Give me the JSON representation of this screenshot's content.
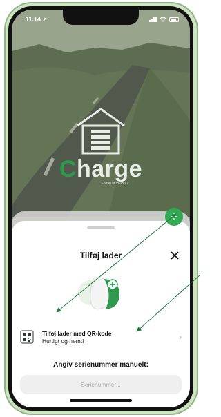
{
  "status_bar": {
    "time": "11.14",
    "location_arrow": "location-arrow-icon"
  },
  "brand": {
    "first_letter": "C",
    "rest": "harge",
    "tagline": "En del af VERDO"
  },
  "fab": {
    "label": "+"
  },
  "sheet": {
    "title": "Tilføj lader",
    "qr_option": {
      "title": "Tilføj lader med QR-kode",
      "subtitle": "Hurtigt og nemt!",
      "chevron": "›"
    },
    "manual_label": "Angiv serienummer manuelt:",
    "serial_placeholder": "Serienummer..."
  },
  "colors": {
    "accent_green": "#34a853",
    "annotation_green": "#1e7a3c"
  }
}
